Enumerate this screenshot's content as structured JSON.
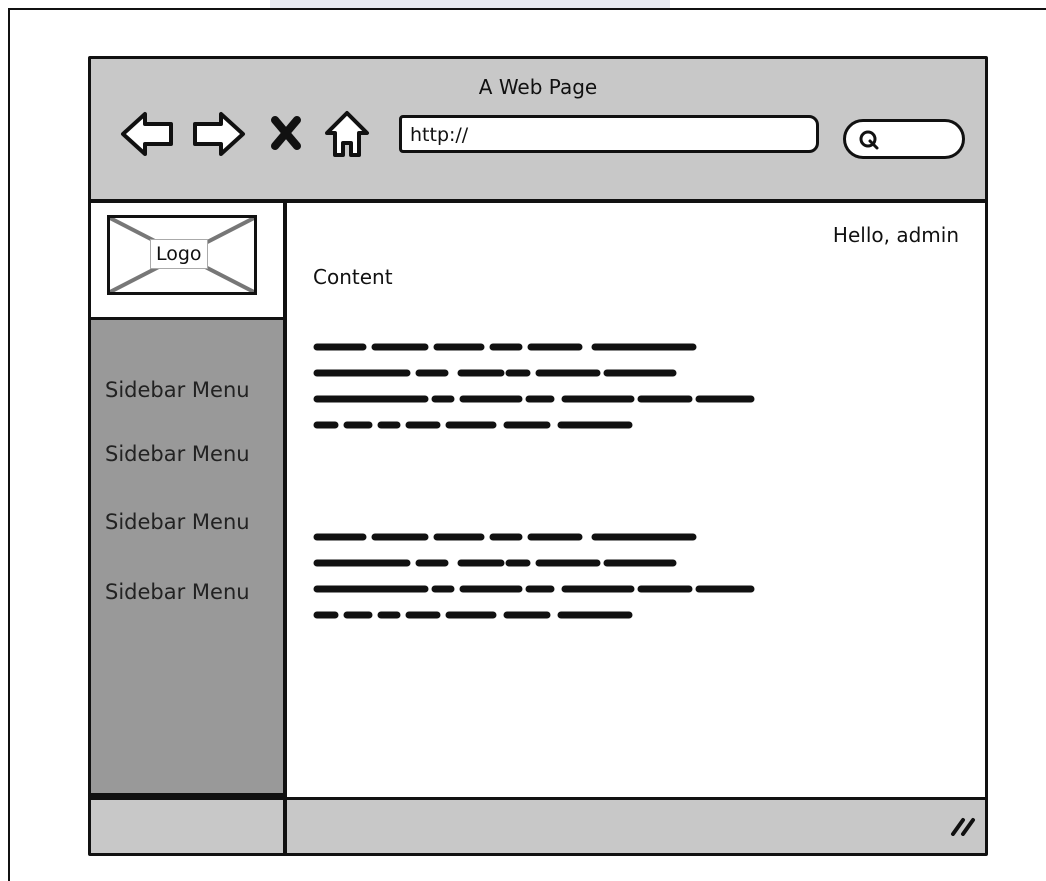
{
  "window": {
    "title": "A Web Page"
  },
  "toolbar": {
    "back_icon": "left-arrow-icon",
    "forward_icon": "right-arrow-icon",
    "stop_icon": "close-x-icon",
    "home_icon": "home-icon",
    "url_value": "http://",
    "search_icon": "search-icon"
  },
  "logo": {
    "label": "Logo"
  },
  "sidebar": {
    "items": [
      {
        "label": "Sidebar Menu"
      },
      {
        "label": "Sidebar Menu"
      },
      {
        "label": "Sidebar Menu"
      },
      {
        "label": "Sidebar Menu"
      }
    ]
  },
  "main": {
    "greeting": "Hello, admin",
    "title": "Content"
  },
  "colors": {
    "chrome": "#c8c8c8",
    "sidebar": "#999999",
    "ink": "#111111",
    "background": "#ffffff"
  }
}
